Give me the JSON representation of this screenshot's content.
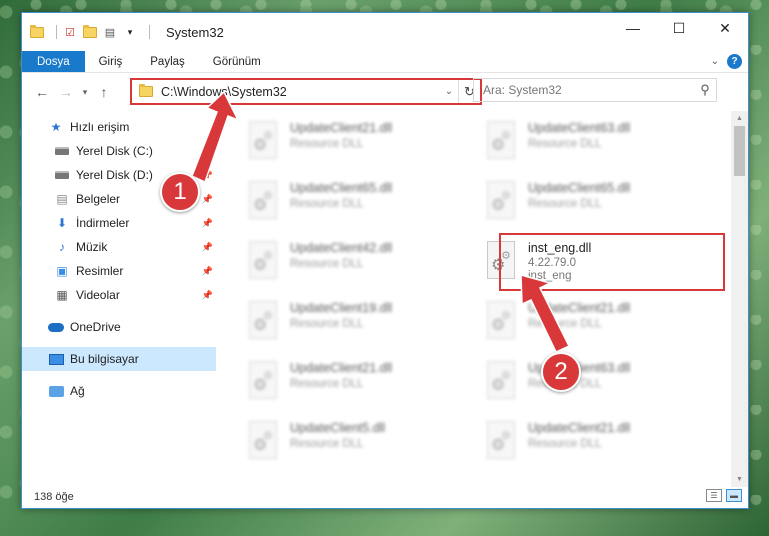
{
  "window": {
    "title": "System32",
    "controls": [
      "—",
      "☐",
      "✕"
    ]
  },
  "ribbon": {
    "tabs": [
      "Dosya",
      "Giriş",
      "Paylaş",
      "Görünüm"
    ],
    "help": "?"
  },
  "nav": {
    "address": "C:\\Windows\\System32",
    "search_placeholder": "Ara: System32"
  },
  "sidebar": {
    "quick_access": "Hızlı erişim",
    "quick_items": [
      {
        "label": "Yerel Disk (C:)",
        "icon": "drive-icon"
      },
      {
        "label": "Yerel Disk (D:)",
        "icon": "drive-icon"
      },
      {
        "label": "Belgeler",
        "icon": "documents-icon"
      },
      {
        "label": "İndirmeler",
        "icon": "download-icon"
      },
      {
        "label": "Müzik",
        "icon": "music-icon"
      },
      {
        "label": "Resimler",
        "icon": "pictures-icon"
      },
      {
        "label": "Videolar",
        "icon": "videos-icon"
      }
    ],
    "onedrive": "OneDrive",
    "this_pc": "Bu bilgisayar",
    "network": "Ağ"
  },
  "files": {
    "left": [
      {
        "name": "UpdateClient21.dll",
        "sub": "Resource DLL"
      },
      {
        "name": "UpdateClient65.dll",
        "sub": "Resource DLL"
      },
      {
        "name": "UpdateClient42.dll",
        "sub": "Resource DLL"
      },
      {
        "name": "UpdateClient19.dll",
        "sub": "Resource DLL"
      },
      {
        "name": "UpdateClient21.dll",
        "sub": "Resource DLL"
      },
      {
        "name": "UpdateClient5.dll",
        "sub": "Resource DLL"
      }
    ],
    "right": [
      {
        "name": "UpdateClient63.dll",
        "sub": "Resource DLL"
      },
      {
        "name": "UpdateClient65.dll",
        "sub": "Resource DLL"
      },
      {
        "name": "inst_eng.dll",
        "sub": "4.22.79.0",
        "sub2": "inst_eng"
      },
      {
        "name": "UpdateClient21.dll",
        "sub": "Resource DLL"
      },
      {
        "name": "UpdateClient63.dll",
        "sub": "Resource DLL"
      },
      {
        "name": "UpdateClient21.dll",
        "sub": "Resource DLL"
      }
    ]
  },
  "status": {
    "count": "138 öğe"
  },
  "callouts": [
    "1",
    "2"
  ],
  "colors": {
    "accent": "#1979ca",
    "highlight": "#d9383a",
    "selected": "#cce8ff"
  }
}
